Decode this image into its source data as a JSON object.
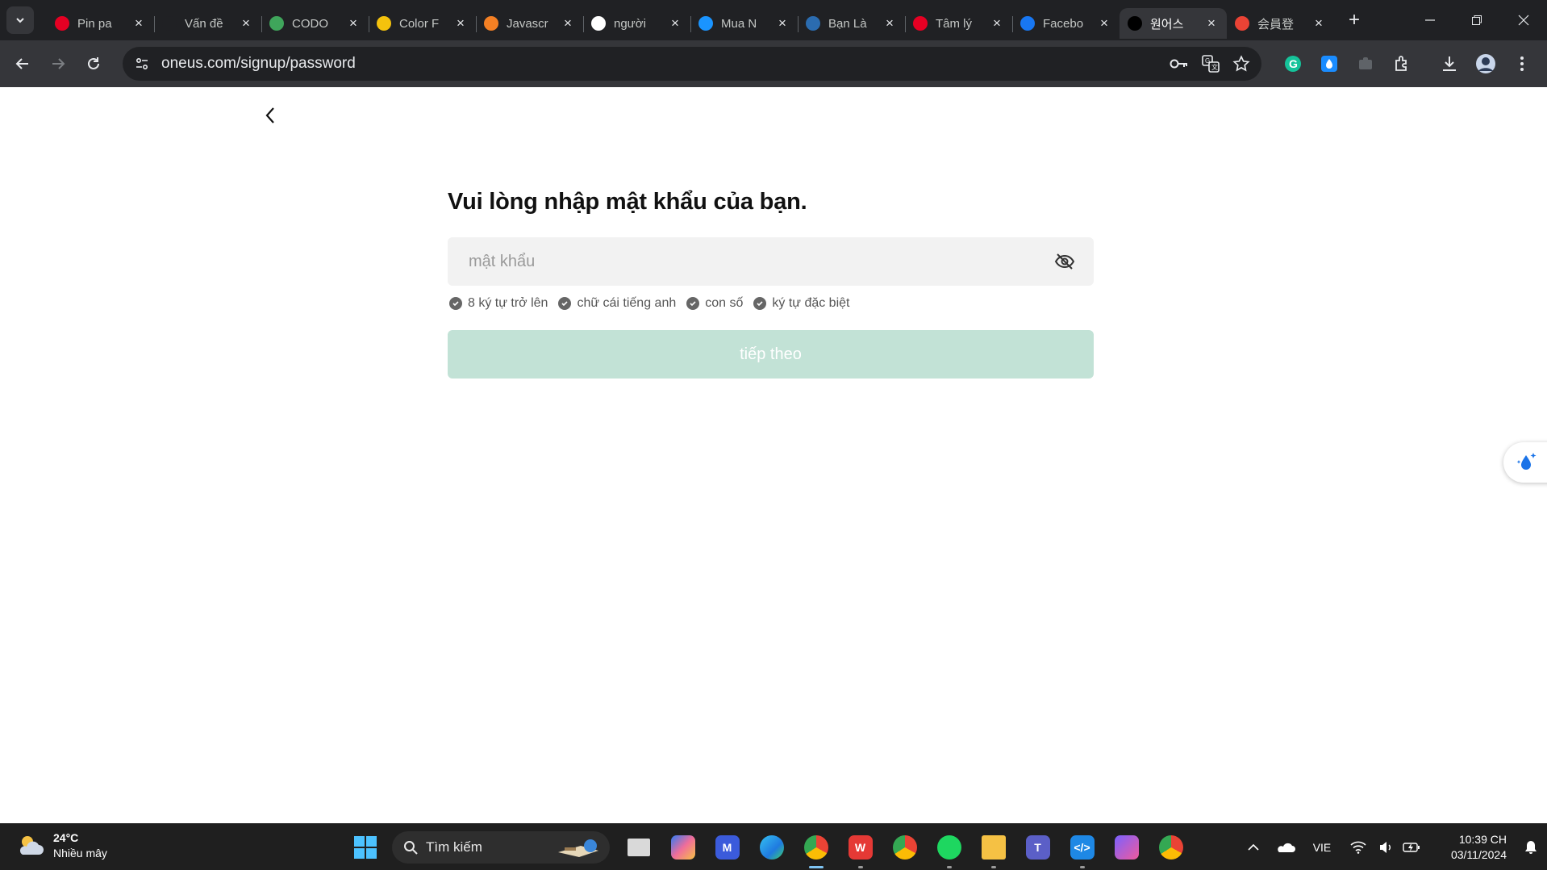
{
  "browser": {
    "tabs": [
      {
        "title": "Pin pa",
        "favicon": "pinterest-icon",
        "color": "#e60023"
      },
      {
        "title": "Vấn đề",
        "favicon": "chatgpt-icon",
        "color": "#202124"
      },
      {
        "title": "CODO",
        "favicon": "codo-icon",
        "color": "#3fa55b"
      },
      {
        "title": "Color F",
        "favicon": "color-icon",
        "color": "#f4c20d"
      },
      {
        "title": "Javascr",
        "favicon": "stackoverflow-icon",
        "color": "#f48024"
      },
      {
        "title": "người",
        "favicon": "google-icon",
        "color": "#ffffff"
      },
      {
        "title": "Mua N",
        "favicon": "tiki-icon",
        "color": "#1a94ff"
      },
      {
        "title": "Bạn Là",
        "favicon": "site-icon",
        "color": "#2b6cb0"
      },
      {
        "title": "Tâm lý",
        "favicon": "pinterest-icon",
        "color": "#e60023"
      },
      {
        "title": "Facebo",
        "favicon": "facebook-icon",
        "color": "#1877f2"
      },
      {
        "title": "원어스",
        "favicon": "oneus-icon",
        "color": "#000000",
        "active": true
      },
      {
        "title": "会員登",
        "favicon": "gmail-icon",
        "color": "#ea4335"
      }
    ],
    "url": "oneus.com/signup/password"
  },
  "page": {
    "heading": "Vui lòng nhập mật khẩu của bạn.",
    "password_placeholder": "mật khẩu",
    "rules": [
      "8 ký tự trở lên",
      "chữ cái tiếng anh",
      "con số",
      "ký tự đặc biệt"
    ],
    "next_label": "tiếp theo",
    "accent_disabled": "#c2e2d6"
  },
  "taskbar": {
    "weather_temp": "24°C",
    "weather_desc": "Nhiều mây",
    "search_label": "Tìm kiếm",
    "language": "VIE",
    "time": "10:39 CH",
    "date": "03/11/2024"
  }
}
